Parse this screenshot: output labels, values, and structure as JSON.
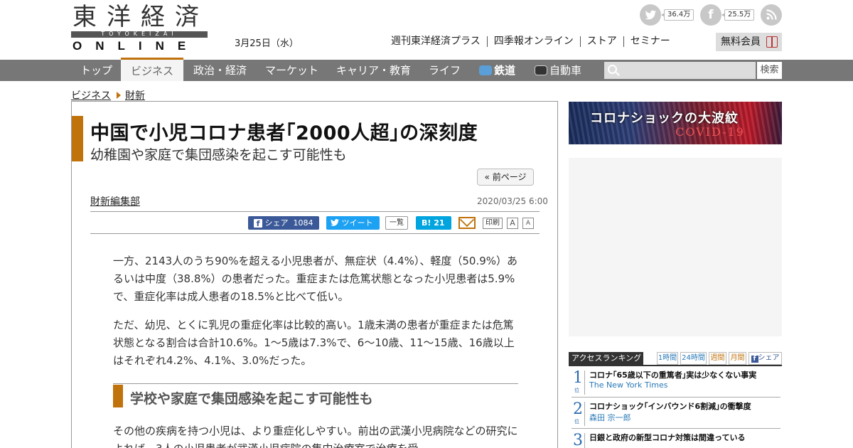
{
  "header": {
    "logo_kanji": "東洋経済",
    "logo_bar": "TOYOKEIZAI",
    "logo_online": "ONLINE",
    "date": "3月25日（水）",
    "social": {
      "twitter_icon": "twitter-bird-icon",
      "twitter_count": "36.4万",
      "facebook_icon": "facebook-f-icon",
      "facebook_count": "25.5万",
      "rss_icon": "rss-icon"
    },
    "top_links": [
      "週刊東洋経済プラス",
      "四季報オンライン",
      "ストア",
      "セミナー"
    ],
    "member_button": "無料会員"
  },
  "global_nav": {
    "items": [
      "トップ",
      "ビジネス",
      "政治・経済",
      "マーケット",
      "キャリア・教育",
      "ライフ",
      "鉄道",
      "自動車"
    ],
    "active": "ビジネス",
    "search_placeholder": "",
    "search_button": "検索"
  },
  "breadcrumb": [
    "ビジネス",
    "財新"
  ],
  "article": {
    "title": "中国で小児コロナ患者｢2000人超｣の深刻度",
    "subtitle": "幼稚園や家庭で集団感染を起こす可能性も",
    "prev_page": "« 前ページ",
    "author": "財新編集部",
    "date": "2020/03/25 6:00",
    "share": {
      "facebook_label": "シェア",
      "facebook_count": "1084",
      "twitter_label": "ツイート",
      "list_label": "一覧",
      "hatena_label": "B!",
      "hatena_count": "21",
      "print": "印刷",
      "font_large": "A",
      "font_small": "A"
    },
    "paragraphs": [
      "一方、2143人のうち90%を超える小児患者が、無症状（4.4%）、軽度（50.9%）あるいは中度（38.8%）の患者だった。重症または危篤状態となった小児患者は5.9%で、重症化率は成人患者の18.5%と比べて低い。",
      "ただ、幼児、とくに乳児の重症化率は比較的高い。1歳未満の患者が重症または危篤状態となる割合は合計10.6%。1～5歳は7.3%で、6～10歳、11～15歳、16歳以上はそれぞれ4.2%、4.1%、3.0%だった。",
      "その他の疾病を持つ小児は、より重症化しやすい。前出の武漢小児病院などの研究によれば、3人の小児患者が武漢小児病院の集中治療室で治療を受"
    ],
    "section_heading": "学校や家庭で集団感染を起こす可能性も"
  },
  "sidebar": {
    "banner_text": "コロナショックの大波紋",
    "banner_sub": "COVID-19",
    "ranking": {
      "title": "アクセスランキング",
      "tabs": [
        "1時間",
        "24時間",
        "週間",
        "月間",
        "シェア"
      ],
      "unit": "位",
      "items": [
        {
          "rank": "1",
          "title": "コロナ｢65歳以下の重篤者｣実は少なくない事実",
          "source": "The New York Times"
        },
        {
          "rank": "2",
          "title": "コロナショック｢インバウンド6割減｣の衝撃度",
          "source": "森田 宗一郎"
        },
        {
          "rank": "3",
          "title": "日銀と政府の新型コロナ対策は間違っている",
          "source": ""
        }
      ]
    }
  },
  "colors": {
    "accent": "#c0720c",
    "nav_bg": "#777777",
    "link_blue": "#2a7ab8",
    "facebook": "#3b5998",
    "twitter": "#1da1f2",
    "hatena": "#00a4de"
  }
}
